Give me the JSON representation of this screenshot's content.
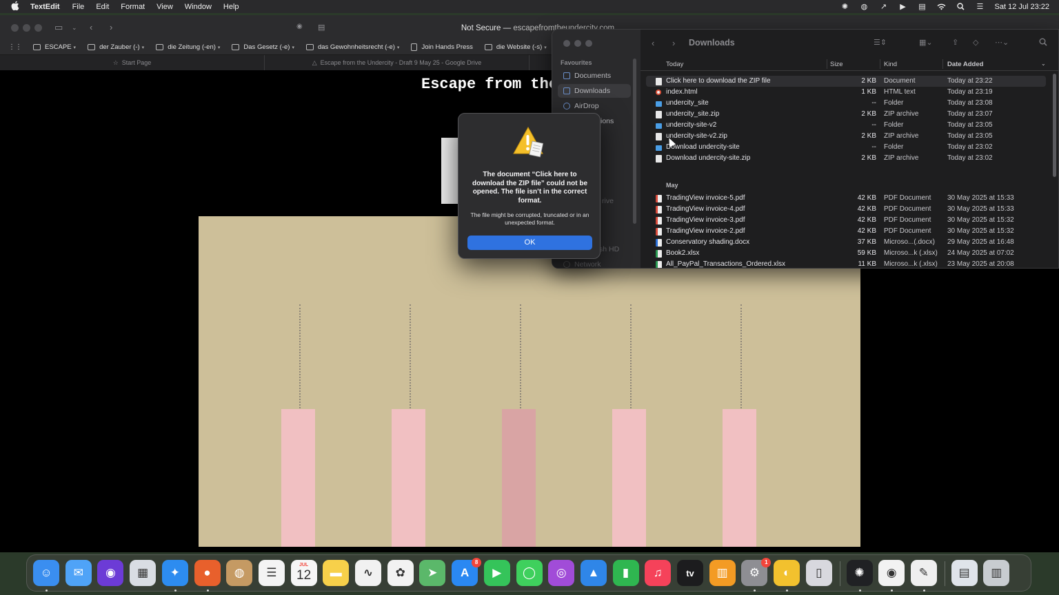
{
  "menubar": {
    "app_name": "TextEdit",
    "menus": [
      "File",
      "Edit",
      "Format",
      "View",
      "Window",
      "Help"
    ],
    "clock": "Sat 12 Jul  23:22"
  },
  "browser": {
    "url_prefix": "Not Secure —",
    "url_domain": "escapefromtheundercity.com",
    "bookmarks": [
      {
        "label": "ESCAPE",
        "has_menu": true,
        "icon": "folder-icon"
      },
      {
        "label": "der Zauber (-)",
        "has_menu": true,
        "icon": "folder-icon"
      },
      {
        "label": "die Zeitung (-en)",
        "has_menu": true,
        "icon": "folder-icon"
      },
      {
        "label": "Das Gesetz (-e)",
        "has_menu": true,
        "icon": "folder-icon"
      },
      {
        "label": "das Gewohnheitsrecht (-e)",
        "has_menu": true,
        "icon": "folder-icon"
      },
      {
        "label": "Join Hands Press",
        "has_menu": false,
        "icon": "page-icon"
      },
      {
        "label": "die Website (-s)",
        "has_menu": true,
        "icon": "folder-icon"
      }
    ],
    "tabs": [
      {
        "label": "Start Page",
        "icon": "star-icon"
      },
      {
        "label": "Escape from the Undercity - Draft 9 May 25 - Google Drive",
        "icon": "drive-icon"
      },
      {
        "label": "",
        "icon": ""
      },
      {
        "label": "",
        "icon": ""
      }
    ],
    "page": {
      "title": "Escape from the"
    }
  },
  "finder": {
    "title": "Downloads",
    "sidebar": {
      "section": "Favourites",
      "items": [
        "Documents",
        "Downloads",
        "AirDrop",
        "ions",
        "rive",
        "sh HD",
        "Network"
      ]
    },
    "columns": {
      "name": "Today",
      "size": "Size",
      "kind": "Kind",
      "date": "Date Added"
    },
    "groups": {
      "today": "Today",
      "may": "May"
    },
    "today_files": [
      {
        "name": "Click here to download the ZIP file",
        "size": "2 KB",
        "kind": "Document",
        "date": "Today at 23:22",
        "type": "doc"
      },
      {
        "name": "index.html",
        "size": "1 KB",
        "kind": "HTML text",
        "date": "Today at 23:19",
        "type": "html"
      },
      {
        "name": "undercity_site",
        "size": "--",
        "kind": "Folder",
        "date": "Today at 23:08",
        "type": "folder"
      },
      {
        "name": "undercity_site.zip",
        "size": "2 KB",
        "kind": "ZIP archive",
        "date": "Today at 23:07",
        "type": "doc"
      },
      {
        "name": "undercity-site-v2",
        "size": "--",
        "kind": "Folder",
        "date": "Today at 23:05",
        "type": "folder"
      },
      {
        "name": "undercity-site-v2.zip",
        "size": "2 KB",
        "kind": "ZIP archive",
        "date": "Today at 23:05",
        "type": "doc"
      },
      {
        "name": "Download undercity-site",
        "size": "--",
        "kind": "Folder",
        "date": "Today at 23:02",
        "type": "folder"
      },
      {
        "name": "Download undercity-site.zip",
        "size": "2 KB",
        "kind": "ZIP archive",
        "date": "Today at 23:02",
        "type": "doc"
      }
    ],
    "may_files": [
      {
        "name": "TradingView invoice-5.pdf",
        "size": "42 KB",
        "kind": "PDF Document",
        "date": "30 May 2025 at 15:33",
        "type": "pdf"
      },
      {
        "name": "TradingView invoice-4.pdf",
        "size": "42 KB",
        "kind": "PDF Document",
        "date": "30 May 2025 at 15:33",
        "type": "pdf"
      },
      {
        "name": "TradingView invoice-3.pdf",
        "size": "42 KB",
        "kind": "PDF Document",
        "date": "30 May 2025 at 15:32",
        "type": "pdf"
      },
      {
        "name": "TradingView invoice-2.pdf",
        "size": "42 KB",
        "kind": "PDF Document",
        "date": "30 May 2025 at 15:32",
        "type": "pdf"
      },
      {
        "name": "Conservatory shading.docx",
        "size": "37 KB",
        "kind": "Microso...(.docx)",
        "date": "29 May 2025 at 16:48",
        "type": "docx"
      },
      {
        "name": "Book2.xlsx",
        "size": "59 KB",
        "kind": "Microso...k (.xlsx)",
        "date": "24 May 2025 at 07:02",
        "type": "xlsx"
      },
      {
        "name": "All_PayPal_Transactions_Ordered.xlsx",
        "size": "11 KB",
        "kind": "Microso...k (.xlsx)",
        "date": "23 May 2025 at 20:08",
        "type": "xlsx"
      }
    ]
  },
  "alert": {
    "title": "The document “Click here to download the ZIP file” could not be opened. The file isn’t in the correct format.",
    "message": "The file might be corrupted, truncated or in an unexpected format.",
    "ok_label": "OK"
  },
  "dock": {
    "calendar_month": "JUL",
    "calendar_day": "12",
    "app_store_badge": "8",
    "settings_badge": "1",
    "apps": [
      {
        "name": "finder-icon",
        "color": "#3a8ef0"
      },
      {
        "name": "mail-icon",
        "color": "#4fa3f7"
      },
      {
        "name": "siri-icon",
        "color": "#6c3bd6"
      },
      {
        "name": "launchpad-icon",
        "color": "#d9dde3"
      },
      {
        "name": "safari-icon",
        "color": "#2d8cf0"
      },
      {
        "name": "firefox-icon",
        "color": "#e8602c"
      },
      {
        "name": "contacts-icon",
        "color": "#c59a63"
      },
      {
        "name": "reminders-icon",
        "color": "#f4f4f4"
      },
      {
        "name": "calendar-icon",
        "color": "#f6f6f6"
      },
      {
        "name": "notes-icon",
        "color": "#f7d04a"
      },
      {
        "name": "freeform-icon",
        "color": "#f1f1f1"
      },
      {
        "name": "photos-icon",
        "color": "#f2f2f2"
      },
      {
        "name": "maps-icon",
        "color": "#5bb86a"
      },
      {
        "name": "app-store-icon",
        "color": "#2a88f2"
      },
      {
        "name": "facetime-icon",
        "color": "#35c45a"
      },
      {
        "name": "messages-icon",
        "color": "#3fd05d"
      },
      {
        "name": "podcasts-icon",
        "color": "#a14cd8"
      },
      {
        "name": "keynote-icon",
        "color": "#2f86e8"
      },
      {
        "name": "numbers-icon",
        "color": "#2fb650"
      },
      {
        "name": "music-icon",
        "color": "#f5425a"
      },
      {
        "name": "tv-icon",
        "color": "#1c1c1e"
      },
      {
        "name": "books-icon",
        "color": "#f39b24"
      },
      {
        "name": "system-settings-icon",
        "color": "#8e8e93"
      },
      {
        "name": "vpn-icon",
        "color": "#f2c12e"
      },
      {
        "name": "iphone-mirroring-icon",
        "color": "#d8d8de"
      },
      {
        "name": "chatgpt-icon",
        "color": "#202124"
      },
      {
        "name": "chrome-icon",
        "color": "#f2f2f2"
      },
      {
        "name": "textedit-icon",
        "color": "#efefef"
      },
      {
        "name": "downloads-stack-icon",
        "color": "#dfe4ea"
      },
      {
        "name": "trash-icon",
        "color": "#c8ccd0"
      }
    ]
  }
}
